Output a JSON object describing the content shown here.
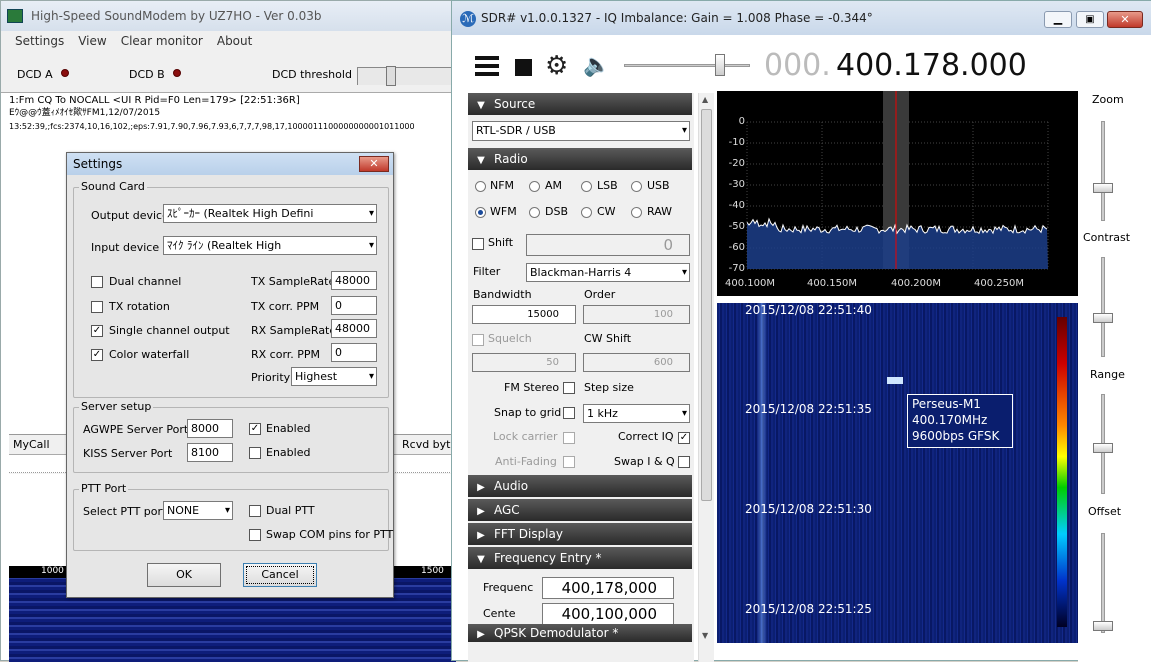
{
  "modem": {
    "title": "High-Speed SoundModem by UZ7HO - Ver 0.03b",
    "menu": [
      "Settings",
      "View",
      "Clear monitor",
      "About"
    ],
    "dcd_a": "DCD A",
    "dcd_b": "DCD B",
    "dcd_threshold": "DCD threshold",
    "monitor_lines": [
      "1:Fm CQ To NOCALL <UI R Pid=F0 Len=179> [22:51:36R]",
      "Eｳ@@ｳ蓋ｨﾒｵｲｾ歟ｻFM1,12/07/2015",
      "13:52:39,;fcs:2374,10,16,102,;eps:7.91,7.90,7.96,7.93,6,7,7,7,98,17,1000011100000000001011000"
    ],
    "grid_col1": "MyCall",
    "grid_col2": "Rcvd byte",
    "wf_scale": [
      "1000",
      "1500"
    ]
  },
  "settings": {
    "title": "Settings",
    "sound_card": "Sound Card",
    "output_device_label": "Output device",
    "output_device": "ｽﾋﾟｰｶｰ (Realtek High Defini",
    "input_device_label": "Input device",
    "input_device": "ﾏｲｸ ﾗｲﾝ (Realtek High",
    "dual_channel": "Dual channel",
    "tx_rotation": "TX rotation",
    "single_channel_output": "Single channel output",
    "color_waterfall": "Color waterfall",
    "tx_samplerate_label": "TX SampleRate",
    "tx_samplerate": "48000",
    "tx_ppm_label": "TX corr. PPM",
    "tx_ppm": "0",
    "rx_samplerate_label": "RX SampleRate",
    "rx_samplerate": "48000",
    "rx_ppm_label": "RX corr. PPM",
    "rx_ppm": "0",
    "priority_label": "Priority",
    "priority": "Highest",
    "server_setup": "Server setup",
    "agwpe_label": "AGWPE Server Port",
    "agwpe_port": "8000",
    "enabled1": "Enabled",
    "kiss_label": "KISS Server Port",
    "kiss_port": "8100",
    "enabled2": "Enabled",
    "ptt_port": "PTT Port",
    "select_ptt_label": "Select PTT port",
    "ptt_value": "NONE",
    "dual_ptt": "Dual PTT",
    "swap_com": "Swap COM pins for PTT",
    "ok": "OK",
    "cancel": "Cancel",
    "checks": {
      "dual_channel": false,
      "tx_rotation": false,
      "single_channel_output": true,
      "color_waterfall": true,
      "enabled1": true,
      "enabled2": false,
      "dual_ptt": false,
      "swap_com": false
    }
  },
  "sdr": {
    "title": "SDR# v1.0.0.1327 - IQ Imbalance: Gain = 1.008 Phase = -0.344°",
    "freq_prefix": "000.",
    "freq_main": "400.178.000",
    "source_hdr": "Source",
    "source_value": "RTL-SDR / USB",
    "radio_hdr": "Radio",
    "modes": [
      "NFM",
      "AM",
      "LSB",
      "USB",
      "WFM",
      "DSB",
      "CW",
      "RAW"
    ],
    "selected_mode": "WFM",
    "shift_label": "Shift",
    "shift_value": "0",
    "filter_label": "Filter",
    "filter_value": "Blackman-Harris 4",
    "bandwidth_label": "Bandwidth",
    "bandwidth_value": "15000",
    "order_label": "Order",
    "order_value": "100",
    "squelch_label": "Squelch",
    "squelch_value": "50",
    "cw_shift_label": "CW Shift",
    "cw_shift_value": "600",
    "fm_stereo": "FM Stereo",
    "step_size": "Step size",
    "snap_to_grid": "Snap to grid",
    "step_value": "1 kHz",
    "lock_carrier": "Lock carrier",
    "correct_iq": "Correct IQ",
    "anti_fading": "Anti-Fading",
    "swap_iq": "Swap I & Q",
    "audio_hdr": "Audio",
    "agc_hdr": "AGC",
    "fft_hdr": "FFT Display",
    "freq_entry_hdr": "Frequency Entry *",
    "frequency_label": "Frequenc",
    "frequency_value": "400,178,000",
    "center_label": "Cente",
    "center_value": "400,100,000",
    "qpsk_hdr": "QPSK Demodulator *",
    "y_ticks": [
      "0",
      "-10",
      "-20",
      "-30",
      "-40",
      "-50",
      "-60",
      "-70"
    ],
    "x_ticks": [
      "400.100M",
      "400.150M",
      "400.200M",
      "400.250M"
    ],
    "timestamps": [
      "2015/12/08 22:51:40",
      "2015/12/08 22:51:35",
      "2015/12/08 22:51:30",
      "2015/12/08 22:51:25"
    ],
    "annotation": [
      "Perseus-M1",
      "400.170MHz",
      "9600bps GFSK"
    ],
    "zoom": "Zoom",
    "contrast": "Contrast",
    "range": "Range",
    "offset": "Offset"
  }
}
